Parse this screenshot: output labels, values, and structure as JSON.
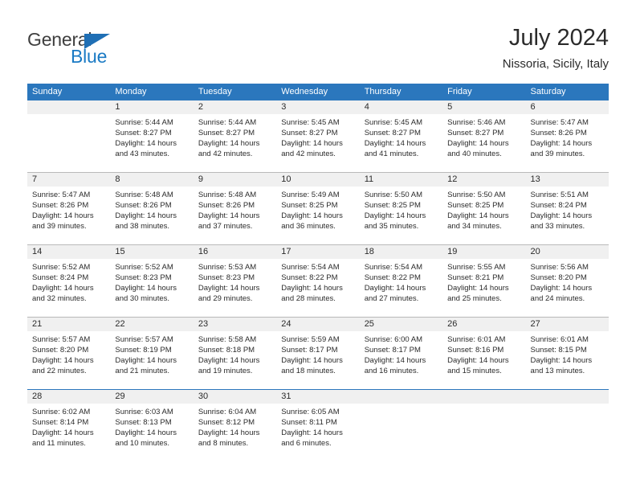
{
  "brand": {
    "name_top": "General",
    "name_bottom": "Blue",
    "triangle_color": "#1f6fb5",
    "blue_color": "#1a7ac4"
  },
  "header": {
    "title": "July 2024",
    "subtitle": "Nissoria, Sicily, Italy"
  },
  "theme": {
    "header_row_bg": "#2b77bd",
    "day_number_band": "#f0f0f0",
    "week_separator": "#b9b9b9",
    "text": "#2b2b2b"
  },
  "weekdays": [
    "Sunday",
    "Monday",
    "Tuesday",
    "Wednesday",
    "Thursday",
    "Friday",
    "Saturday"
  ],
  "weeks": [
    {
      "separator": "gray",
      "days": [
        {
          "num": "",
          "sunrise": "",
          "sunset": "",
          "daylight_a": "",
          "daylight_b": ""
        },
        {
          "num": "1",
          "sunrise": "Sunrise: 5:44 AM",
          "sunset": "Sunset: 8:27 PM",
          "daylight_a": "Daylight: 14 hours",
          "daylight_b": "and 43 minutes."
        },
        {
          "num": "2",
          "sunrise": "Sunrise: 5:44 AM",
          "sunset": "Sunset: 8:27 PM",
          "daylight_a": "Daylight: 14 hours",
          "daylight_b": "and 42 minutes."
        },
        {
          "num": "3",
          "sunrise": "Sunrise: 5:45 AM",
          "sunset": "Sunset: 8:27 PM",
          "daylight_a": "Daylight: 14 hours",
          "daylight_b": "and 42 minutes."
        },
        {
          "num": "4",
          "sunrise": "Sunrise: 5:45 AM",
          "sunset": "Sunset: 8:27 PM",
          "daylight_a": "Daylight: 14 hours",
          "daylight_b": "and 41 minutes."
        },
        {
          "num": "5",
          "sunrise": "Sunrise: 5:46 AM",
          "sunset": "Sunset: 8:27 PM",
          "daylight_a": "Daylight: 14 hours",
          "daylight_b": "and 40 minutes."
        },
        {
          "num": "6",
          "sunrise": "Sunrise: 5:47 AM",
          "sunset": "Sunset: 8:26 PM",
          "daylight_a": "Daylight: 14 hours",
          "daylight_b": "and 39 minutes."
        }
      ]
    },
    {
      "separator": "gray",
      "days": [
        {
          "num": "7",
          "sunrise": "Sunrise: 5:47 AM",
          "sunset": "Sunset: 8:26 PM",
          "daylight_a": "Daylight: 14 hours",
          "daylight_b": "and 39 minutes."
        },
        {
          "num": "8",
          "sunrise": "Sunrise: 5:48 AM",
          "sunset": "Sunset: 8:26 PM",
          "daylight_a": "Daylight: 14 hours",
          "daylight_b": "and 38 minutes."
        },
        {
          "num": "9",
          "sunrise": "Sunrise: 5:48 AM",
          "sunset": "Sunset: 8:26 PM",
          "daylight_a": "Daylight: 14 hours",
          "daylight_b": "and 37 minutes."
        },
        {
          "num": "10",
          "sunrise": "Sunrise: 5:49 AM",
          "sunset": "Sunset: 8:25 PM",
          "daylight_a": "Daylight: 14 hours",
          "daylight_b": "and 36 minutes."
        },
        {
          "num": "11",
          "sunrise": "Sunrise: 5:50 AM",
          "sunset": "Sunset: 8:25 PM",
          "daylight_a": "Daylight: 14 hours",
          "daylight_b": "and 35 minutes."
        },
        {
          "num": "12",
          "sunrise": "Sunrise: 5:50 AM",
          "sunset": "Sunset: 8:25 PM",
          "daylight_a": "Daylight: 14 hours",
          "daylight_b": "and 34 minutes."
        },
        {
          "num": "13",
          "sunrise": "Sunrise: 5:51 AM",
          "sunset": "Sunset: 8:24 PM",
          "daylight_a": "Daylight: 14 hours",
          "daylight_b": "and 33 minutes."
        }
      ]
    },
    {
      "separator": "gray",
      "days": [
        {
          "num": "14",
          "sunrise": "Sunrise: 5:52 AM",
          "sunset": "Sunset: 8:24 PM",
          "daylight_a": "Daylight: 14 hours",
          "daylight_b": "and 32 minutes."
        },
        {
          "num": "15",
          "sunrise": "Sunrise: 5:52 AM",
          "sunset": "Sunset: 8:23 PM",
          "daylight_a": "Daylight: 14 hours",
          "daylight_b": "and 30 minutes."
        },
        {
          "num": "16",
          "sunrise": "Sunrise: 5:53 AM",
          "sunset": "Sunset: 8:23 PM",
          "daylight_a": "Daylight: 14 hours",
          "daylight_b": "and 29 minutes."
        },
        {
          "num": "17",
          "sunrise": "Sunrise: 5:54 AM",
          "sunset": "Sunset: 8:22 PM",
          "daylight_a": "Daylight: 14 hours",
          "daylight_b": "and 28 minutes."
        },
        {
          "num": "18",
          "sunrise": "Sunrise: 5:54 AM",
          "sunset": "Sunset: 8:22 PM",
          "daylight_a": "Daylight: 14 hours",
          "daylight_b": "and 27 minutes."
        },
        {
          "num": "19",
          "sunrise": "Sunrise: 5:55 AM",
          "sunset": "Sunset: 8:21 PM",
          "daylight_a": "Daylight: 14 hours",
          "daylight_b": "and 25 minutes."
        },
        {
          "num": "20",
          "sunrise": "Sunrise: 5:56 AM",
          "sunset": "Sunset: 8:20 PM",
          "daylight_a": "Daylight: 14 hours",
          "daylight_b": "and 24 minutes."
        }
      ]
    },
    {
      "separator": "gray",
      "days": [
        {
          "num": "21",
          "sunrise": "Sunrise: 5:57 AM",
          "sunset": "Sunset: 8:20 PM",
          "daylight_a": "Daylight: 14 hours",
          "daylight_b": "and 22 minutes."
        },
        {
          "num": "22",
          "sunrise": "Sunrise: 5:57 AM",
          "sunset": "Sunset: 8:19 PM",
          "daylight_a": "Daylight: 14 hours",
          "daylight_b": "and 21 minutes."
        },
        {
          "num": "23",
          "sunrise": "Sunrise: 5:58 AM",
          "sunset": "Sunset: 8:18 PM",
          "daylight_a": "Daylight: 14 hours",
          "daylight_b": "and 19 minutes."
        },
        {
          "num": "24",
          "sunrise": "Sunrise: 5:59 AM",
          "sunset": "Sunset: 8:17 PM",
          "daylight_a": "Daylight: 14 hours",
          "daylight_b": "and 18 minutes."
        },
        {
          "num": "25",
          "sunrise": "Sunrise: 6:00 AM",
          "sunset": "Sunset: 8:17 PM",
          "daylight_a": "Daylight: 14 hours",
          "daylight_b": "and 16 minutes."
        },
        {
          "num": "26",
          "sunrise": "Sunrise: 6:01 AM",
          "sunset": "Sunset: 8:16 PM",
          "daylight_a": "Daylight: 14 hours",
          "daylight_b": "and 15 minutes."
        },
        {
          "num": "27",
          "sunrise": "Sunrise: 6:01 AM",
          "sunset": "Sunset: 8:15 PM",
          "daylight_a": "Daylight: 14 hours",
          "daylight_b": "and 13 minutes."
        }
      ]
    },
    {
      "separator": "blue",
      "days": [
        {
          "num": "28",
          "sunrise": "Sunrise: 6:02 AM",
          "sunset": "Sunset: 8:14 PM",
          "daylight_a": "Daylight: 14 hours",
          "daylight_b": "and 11 minutes."
        },
        {
          "num": "29",
          "sunrise": "Sunrise: 6:03 AM",
          "sunset": "Sunset: 8:13 PM",
          "daylight_a": "Daylight: 14 hours",
          "daylight_b": "and 10 minutes."
        },
        {
          "num": "30",
          "sunrise": "Sunrise: 6:04 AM",
          "sunset": "Sunset: 8:12 PM",
          "daylight_a": "Daylight: 14 hours",
          "daylight_b": "and 8 minutes."
        },
        {
          "num": "31",
          "sunrise": "Sunrise: 6:05 AM",
          "sunset": "Sunset: 8:11 PM",
          "daylight_a": "Daylight: 14 hours",
          "daylight_b": "and 6 minutes."
        },
        {
          "num": "",
          "sunrise": "",
          "sunset": "",
          "daylight_a": "",
          "daylight_b": ""
        },
        {
          "num": "",
          "sunrise": "",
          "sunset": "",
          "daylight_a": "",
          "daylight_b": ""
        },
        {
          "num": "",
          "sunrise": "",
          "sunset": "",
          "daylight_a": "",
          "daylight_b": ""
        }
      ]
    }
  ]
}
